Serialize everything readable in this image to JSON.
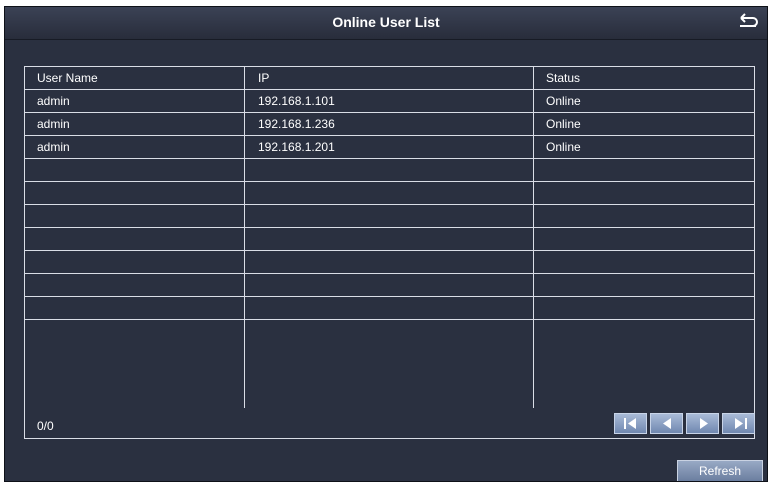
{
  "window": {
    "title": "Online User List"
  },
  "table": {
    "columns": [
      "User Name",
      "IP",
      "Status"
    ],
    "rows": [
      [
        "admin",
        "192.168.1.101",
        "Online"
      ],
      [
        "admin",
        "192.168.1.236",
        "Online"
      ],
      [
        "admin",
        "192.168.1.201",
        "Online"
      ]
    ],
    "empty_row_count": 7
  },
  "pagination": {
    "page_info": "0/0"
  },
  "actions": {
    "refresh_label": "Refresh"
  },
  "icons": {
    "back": "back-arrow-icon",
    "first": "first-page-icon",
    "prev": "previous-page-icon",
    "next": "next-page-icon",
    "last": "last-page-icon"
  },
  "colors": {
    "background": "#2a3040",
    "grid": "#d9dde6",
    "button": "#7088b0",
    "text": "#ffffff"
  }
}
